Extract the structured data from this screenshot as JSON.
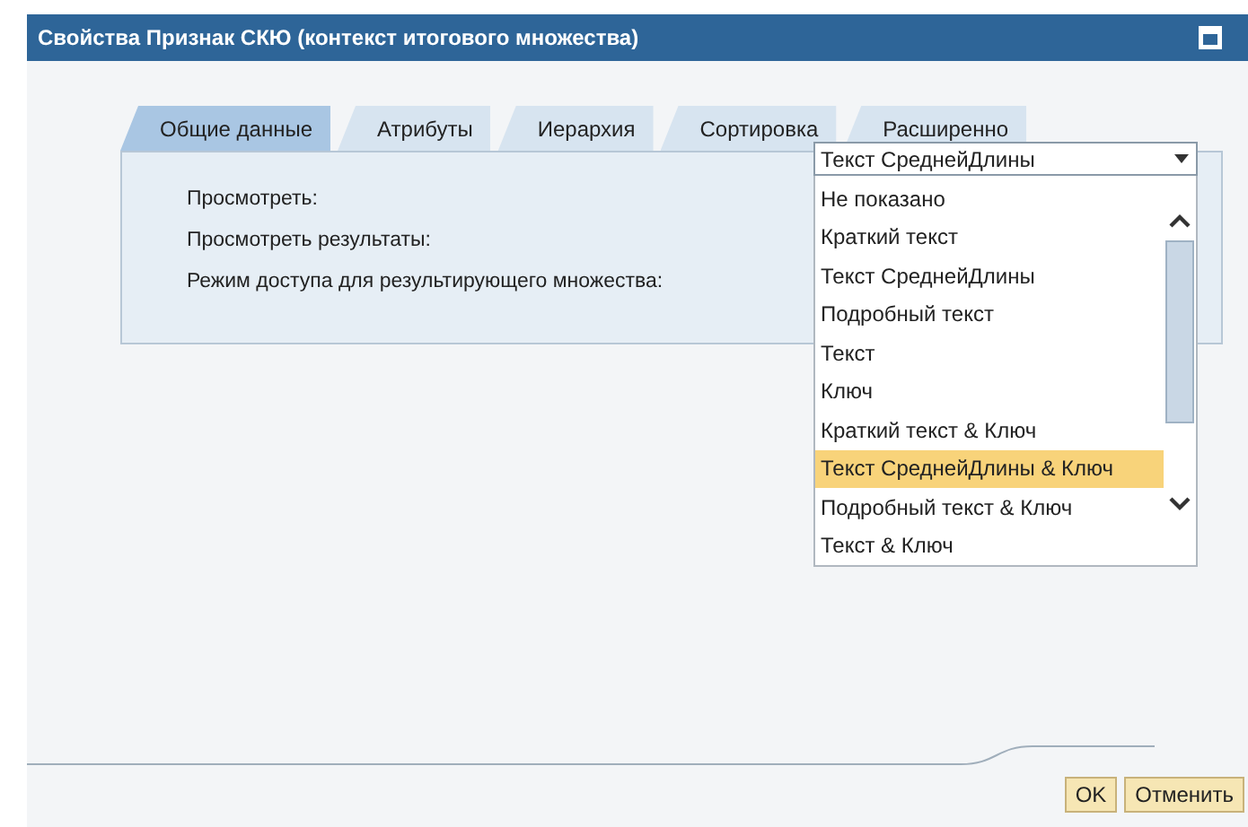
{
  "window": {
    "title": "Свойства Признак СКЮ (контекст итогового множества)"
  },
  "tabs": [
    {
      "label": "Общие данные",
      "selected": true
    },
    {
      "label": "Атрибуты",
      "selected": false
    },
    {
      "label": "Иерархия",
      "selected": false
    },
    {
      "label": "Сортировка",
      "selected": false
    },
    {
      "label": "Расширенно",
      "selected": false
    }
  ],
  "fields": [
    {
      "label": "Просмотреть:"
    },
    {
      "label": "Просмотреть результаты:"
    },
    {
      "label": "Режим доступа для результирующего множества:"
    }
  ],
  "dropdown": {
    "value": "Текст СреднейДлины",
    "options": [
      {
        "label": "Не показано",
        "highlighted": false
      },
      {
        "label": "Краткий текст",
        "highlighted": false
      },
      {
        "label": "Текст СреднейДлины",
        "highlighted": false
      },
      {
        "label": "Подробный текст",
        "highlighted": false
      },
      {
        "label": "Текст",
        "highlighted": false
      },
      {
        "label": "Ключ",
        "highlighted": false
      },
      {
        "label": "Краткий текст & Ключ",
        "highlighted": false
      },
      {
        "label": "Текст СреднейДлины & Ключ",
        "highlighted": true
      },
      {
        "label": "Подробный текст & Ключ",
        "highlighted": false
      },
      {
        "label": "Текст & Ключ",
        "highlighted": false
      }
    ]
  },
  "buttons": [
    "OK",
    "Отменить"
  ]
}
